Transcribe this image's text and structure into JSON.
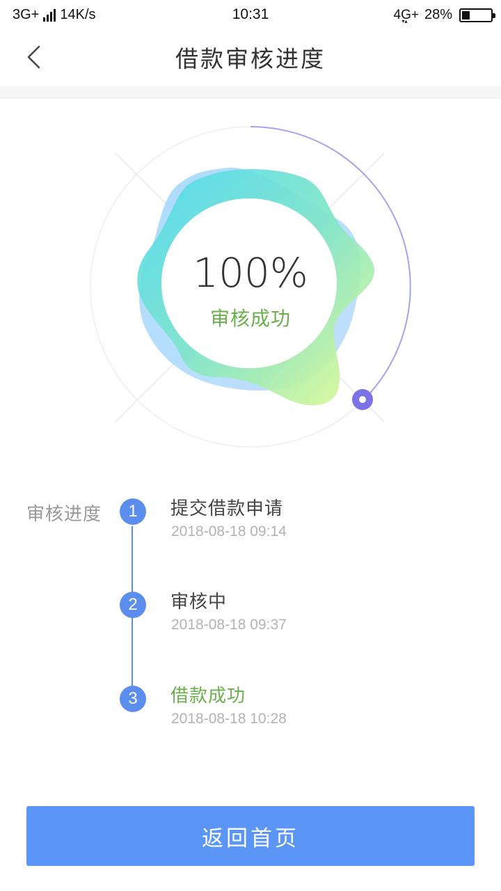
{
  "status_bar": {
    "network_left": "3G+",
    "speed": "14K/s",
    "time": "10:31",
    "network_right": "4G+",
    "battery_pct": "28%",
    "battery_level": 0.28
  },
  "nav": {
    "title": "借款审核进度"
  },
  "progress": {
    "value": "100%",
    "status": "审核成功",
    "fraction": 1.0
  },
  "timeline": {
    "label": "审核进度",
    "steps": [
      {
        "num": "1",
        "title": "提交借款申请",
        "time": "2018-08-18   09:14"
      },
      {
        "num": "2",
        "title": "审核中",
        "time": "2018-08-18   09:37"
      },
      {
        "num": "3",
        "title": "借款成功",
        "time": "2018-08-18   10:28"
      }
    ]
  },
  "actions": {
    "home_label": "返回首页"
  },
  "colors": {
    "accent": "#5b96f7",
    "success": "#6ab04c",
    "ring_indicator": "#7b72e8"
  }
}
